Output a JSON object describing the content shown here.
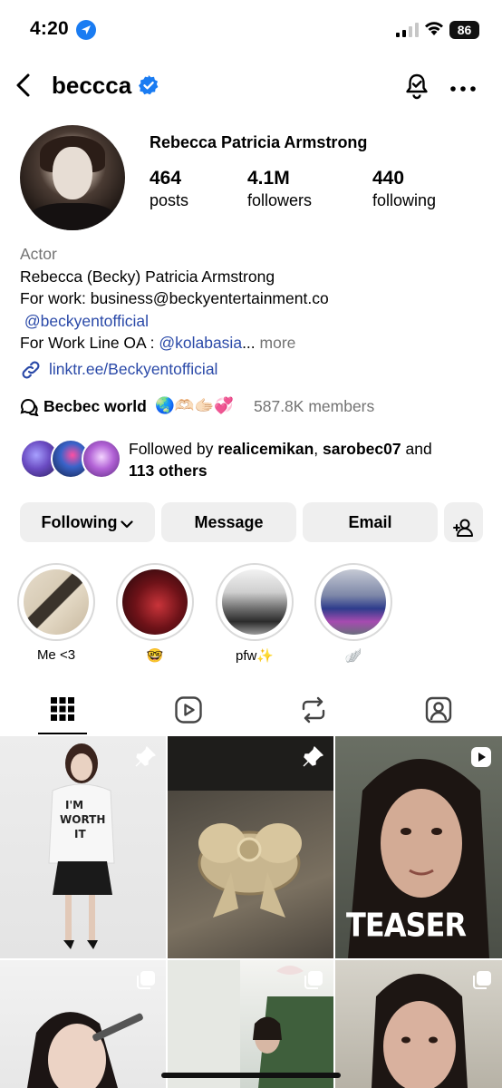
{
  "status_bar": {
    "time": "4:20",
    "battery": "86"
  },
  "header": {
    "username": "beccca"
  },
  "profile": {
    "full_name": "Rebecca Patricia Armstrong",
    "stats": [
      {
        "value": "464",
        "label": "posts"
      },
      {
        "value": "4.1M",
        "label": "followers"
      },
      {
        "value": "440",
        "label": "following"
      }
    ],
    "category": "Actor",
    "bio_line1": "Rebecca (Becky) Patricia Armstrong",
    "bio_line2": "For work: business@beckyentertainment.co",
    "bio_mention": "@beckyentofficial",
    "bio_line4_prefix": "For Work Line OA : ",
    "bio_line4_mention": "@kolabasia",
    "bio_line4_ellipsis": "...",
    "bio_more": "more",
    "link": "linktr.ee/Beckyentofficial",
    "channel": {
      "name": "Becbec world",
      "emoji": "🌏🫶🏻🫱🏻💞",
      "members": "587.8K members"
    },
    "followed_by": {
      "prefix": "Followed by ",
      "user1": "realicemikan",
      "sep": ", ",
      "user2": "sarobec07",
      "and": " and",
      "others": "113 others"
    }
  },
  "buttons": {
    "following": "Following",
    "message": "Message",
    "email": "Email"
  },
  "highlights": [
    {
      "label": "Me <3"
    },
    {
      "label": "🤓"
    },
    {
      "label": "pfw✨"
    },
    {
      "label": "🪽"
    }
  ],
  "tabs": [
    "grid-icon",
    "reels-icon",
    "reposts-icon",
    "tagged-icon"
  ],
  "grid_posts": [
    {
      "badge": "pin-icon",
      "overlay_text": ""
    },
    {
      "badge": "pin-icon",
      "overlay_text": ""
    },
    {
      "badge": "reel-icon",
      "overlay_text": "TEASER"
    },
    {
      "badge": "carousel-icon",
      "overlay_text": ""
    },
    {
      "badge": "carousel-icon",
      "overlay_text": ""
    },
    {
      "badge": "carousel-icon",
      "overlay_text": ""
    }
  ],
  "colors": {
    "verified": "#1a7cf2",
    "link": "#2a49a8",
    "button_bg": "#efefef",
    "muted": "#737373"
  }
}
